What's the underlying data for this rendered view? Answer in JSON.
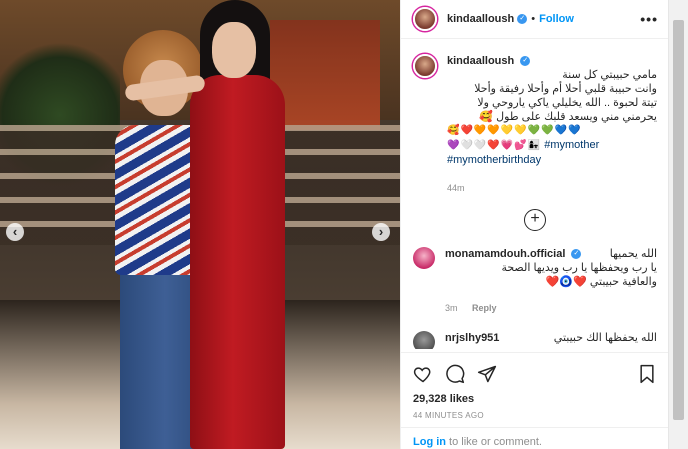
{
  "header": {
    "username": "kindaalloush",
    "separator": "•",
    "follow_label": "Follow",
    "more_label": "•••"
  },
  "caption": {
    "username": "kindaalloush",
    "text_line1": "مامي حبيبتي كل سنة",
    "text_line2": "وانت حبيبة قلبي أحلا أم وأحلا رفيقة وأحلا",
    "text_line3": "تيتة لحبوة .. الله يخليلي ياكي ياروحي ولا",
    "text_line4": "يحرمني مني ويسعد قلبك على طول 🥰",
    "emoji_line1": "🥰❤️🧡🧡💛💛💚💚💙💙",
    "emoji_line2": "💜🤍🤍❤️💗💕👩‍👧",
    "hashtag1": "#mymother",
    "hashtag2": "#mymotherbirthday",
    "time": "44m"
  },
  "load_more_label": "+",
  "comments": [
    {
      "username": "monamamdouh.official",
      "text_line1": "الله يحميها",
      "text_line2": "يا رب ويحفظها يا رب ويديها الصحة",
      "text_line3": "والعافية حبيبتي ❤️🧿❤️",
      "time": "3m",
      "reply_label": "Reply"
    },
    {
      "username": "nrjslhy951",
      "text_line1": "الله يحفظها الك حبيبتي"
    }
  ],
  "actions": {
    "likes": "29,328 likes",
    "posted": "44 MINUTES AGO"
  },
  "add_comment": {
    "login_label": "Log in",
    "rest": " to like or comment."
  },
  "colors": {
    "accent": "#0095f6",
    "verified": "#3897f0",
    "text": "#262626",
    "muted": "#8e8e8e"
  }
}
